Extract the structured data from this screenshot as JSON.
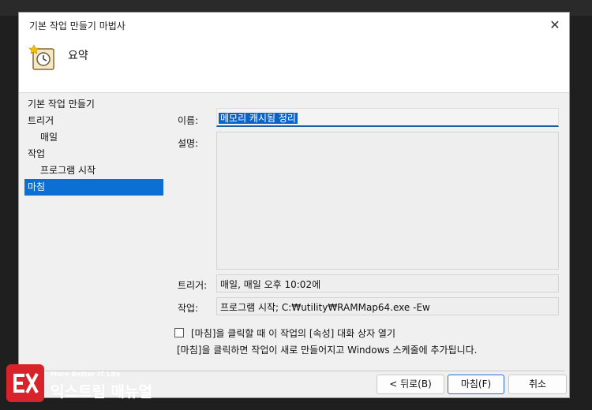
{
  "window": {
    "title": "기본 작업 만들기 마법사",
    "close_glyph": "✕"
  },
  "header": {
    "title": "요약",
    "icon": "clock-task-icon"
  },
  "nav": {
    "items": [
      {
        "label": "기본 작업 만들기"
      },
      {
        "label": "트리거"
      },
      {
        "label": "매일"
      },
      {
        "label": "작업"
      },
      {
        "label": "프로그램 시작"
      },
      {
        "label": "마침"
      }
    ]
  },
  "form": {
    "name_label": "이름:",
    "name_value": "메모리 캐시됨 정리",
    "desc_label": "설명:",
    "desc_value": "",
    "trigger_label": "트리거:",
    "trigger_value": "매일, 매일 오후 10:02에",
    "action_label": "작업:",
    "action_value": "프로그램 시작; C:₩utility₩RAMMap64.exe -Ew"
  },
  "options": {
    "open_properties_label": "[마침]을 클릭할 때 이 작업의 [속성] 대화 상자 열기",
    "open_properties_checked": false,
    "hint": "[마침]을 클릭하면 작업이 새로 만들어지고 Windows 스케줄에 추가됩니다."
  },
  "buttons": {
    "back": "< 뒤로(B)",
    "finish": "마침(F)",
    "cancel": "취소"
  },
  "watermark": {
    "tagline": "More Better IT Life",
    "name": "익스트림 매뉴얼"
  },
  "colors": {
    "accent": "#0b6fd3",
    "brand_red": "#d8232a"
  }
}
